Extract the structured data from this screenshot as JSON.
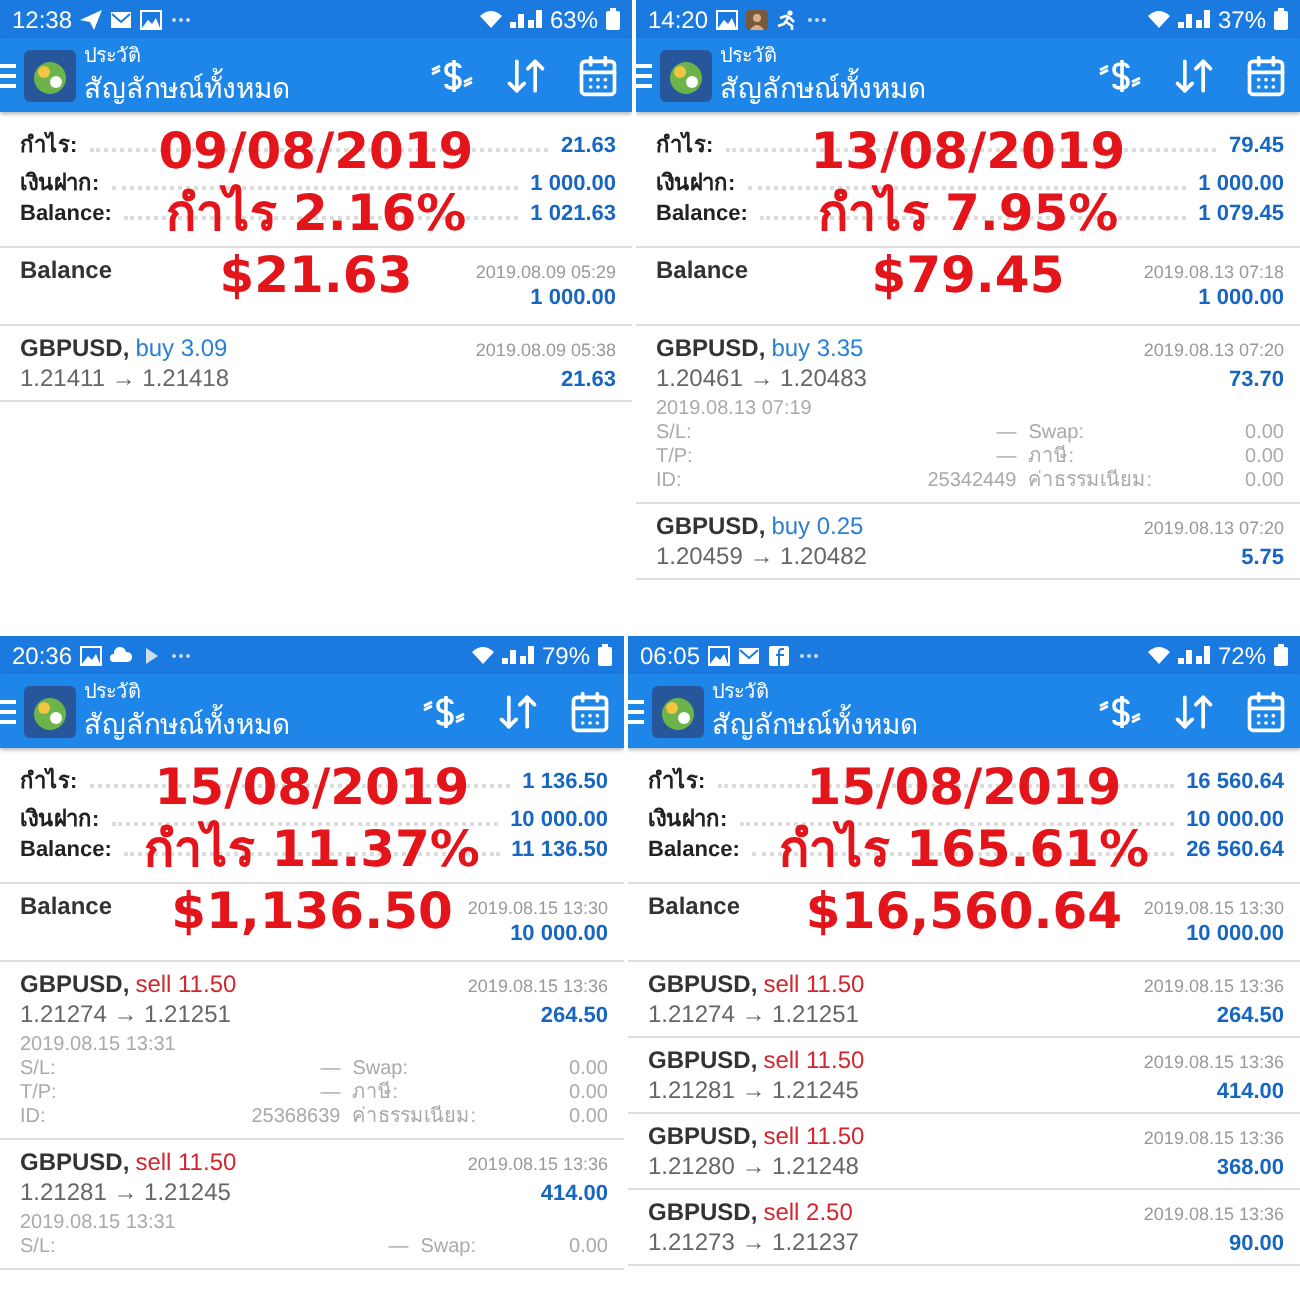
{
  "panels": [
    {
      "status_bar": {
        "time": "12:38",
        "icons": [
          {
            "kind": "send"
          },
          {
            "kind": "mail"
          },
          {
            "kind": "image"
          },
          {
            "kind": "dots"
          }
        ],
        "battery": "63%"
      },
      "header": {
        "subtitle": "ประวัติ",
        "title": "สัญลักษณ์ทั้งหมด"
      },
      "summary": [
        {
          "label": "กำไร:",
          "value": "21.63"
        },
        {
          "label": "เงินฝาก:",
          "value": "1 000.00"
        },
        {
          "label": "Balance:",
          "value": "1 021.63"
        }
      ],
      "overlay": [
        "09/08/2019",
        "กำไร 2.16%",
        "$21.63"
      ],
      "deals": [
        {
          "kind": "balance",
          "title": "Balance",
          "time": "2019.08.09 05:29",
          "amount": "1 000.00"
        },
        {
          "kind": "trade",
          "symbol": "GBPUSD,",
          "color": "#2a7fd4",
          "order": "buy 3.09",
          "prices": "1.21411 → 1.21418",
          "time": "2019.08.09 05:38",
          "amount": "21.63"
        }
      ]
    },
    {
      "status_bar": {
        "time": "14:20",
        "icons": [
          {
            "kind": "image"
          },
          {
            "kind": "avatar"
          },
          {
            "kind": "run"
          },
          {
            "kind": "dots"
          }
        ],
        "battery": "37%"
      },
      "header": {
        "subtitle": "ประวัติ",
        "title": "สัญลักษณ์ทั้งหมด"
      },
      "summary": [
        {
          "label": "กำไร:",
          "value": "79.45"
        },
        {
          "label": "เงินฝาก:",
          "value": "1 000.00"
        },
        {
          "label": "Balance:",
          "value": "1 079.45"
        }
      ],
      "overlay": [
        "13/08/2019",
        "กำไร 7.95%",
        "$79.45"
      ],
      "deals": [
        {
          "kind": "balance",
          "title": "Balance",
          "time": "2019.08.13 07:18",
          "amount": "1 000.00"
        },
        {
          "kind": "trade",
          "symbol": "GBPUSD,",
          "color": "#2a7fd4",
          "order": "buy 3.35",
          "prices": "1.20461 → 1.20483",
          "time": "2019.08.13 07:20",
          "amount": "73.70",
          "details": {
            "open_time": "2019.08.13 07:19",
            "rows": [
              {
                "label": "S/L:",
                "value": "—",
                "label2": "Swap:",
                "value2": "0.00"
              },
              {
                "label": "T/P:",
                "value": "—",
                "label2": "ภาษี:",
                "value2": "0.00"
              },
              {
                "label": "ID:",
                "value": "25342449",
                "label2": "ค่าธรรมเนียม:",
                "value2": "0.00"
              }
            ]
          }
        },
        {
          "kind": "trade",
          "symbol": "GBPUSD,",
          "color": "#2a7fd4",
          "order": "buy 0.25",
          "prices": "1.20459 → 1.20482",
          "time": "2019.08.13 07:20",
          "amount": "5.75"
        }
      ]
    },
    {
      "status_bar": {
        "time": "20:36",
        "icons": [
          {
            "kind": "image"
          },
          {
            "kind": "cloud"
          },
          {
            "kind": "play"
          },
          {
            "kind": "dots"
          }
        ],
        "battery": "79%"
      },
      "header": {
        "subtitle": "ประวัติ",
        "title": "สัญลักษณ์ทั้งหมด"
      },
      "summary": [
        {
          "label": "กำไร:",
          "value": "1 136.50"
        },
        {
          "label": "เงินฝาก:",
          "value": "10 000.00"
        },
        {
          "label": "Balance:",
          "value": "11 136.50"
        }
      ],
      "overlay": [
        "15/08/2019",
        "กำไร 11.37%",
        "$1,136.50"
      ],
      "deals": [
        {
          "kind": "balance",
          "title": "Balance",
          "time": "2019.08.15 13:30",
          "amount": "10 000.00"
        },
        {
          "kind": "trade",
          "symbol": "GBPUSD,",
          "color": "#d0262e",
          "order": "sell 11.50",
          "prices": "1.21274 → 1.21251",
          "time": "2019.08.15 13:36",
          "amount": "264.50",
          "details": {
            "open_time": "2019.08.15 13:31",
            "rows": [
              {
                "label": "S/L:",
                "value": "—",
                "label2": "Swap:",
                "value2": "0.00"
              },
              {
                "label": "T/P:",
                "value": "—",
                "label2": "ภาษี:",
                "value2": "0.00"
              },
              {
                "label": "ID:",
                "value": "25368639",
                "label2": "ค่าธรรมเนียม:",
                "value2": "0.00"
              }
            ]
          }
        },
        {
          "kind": "trade",
          "symbol": "GBPUSD,",
          "color": "#d0262e",
          "order": "sell 11.50",
          "prices": "1.21281 → 1.21245",
          "time": "2019.08.15 13:36",
          "amount": "414.00",
          "details": {
            "open_time": "2019.08.15 13:31",
            "rows": [
              {
                "label": "S/L:",
                "value": "—",
                "label2": "Swap:",
                "value2": "0.00"
              }
            ]
          }
        }
      ]
    },
    {
      "status_bar": {
        "time": "06:05",
        "icons": [
          {
            "kind": "image"
          },
          {
            "kind": "mail"
          },
          {
            "kind": "facebook"
          },
          {
            "kind": "dots"
          }
        ],
        "battery": "72%"
      },
      "header": {
        "subtitle": "ประวัติ",
        "title": "สัญลักษณ์ทั้งหมด"
      },
      "summary": [
        {
          "label": "กำไร:",
          "value": "16 560.64"
        },
        {
          "label": "เงินฝาก:",
          "value": "10 000.00"
        },
        {
          "label": "Balance:",
          "value": "26 560.64"
        }
      ],
      "overlay": [
        "15/08/2019",
        "กำไร 165.61%",
        "$16,560.64"
      ],
      "deals": [
        {
          "kind": "balance",
          "title": "Balance",
          "time": "2019.08.15 13:30",
          "amount": "10 000.00"
        },
        {
          "kind": "trade",
          "symbol": "GBPUSD,",
          "color": "#d0262e",
          "order": "sell 11.50",
          "prices": "1.21274 → 1.21251",
          "time": "2019.08.15 13:36",
          "amount": "264.50"
        },
        {
          "kind": "trade",
          "symbol": "GBPUSD,",
          "color": "#d0262e",
          "order": "sell 11.50",
          "prices": "1.21281 → 1.21245",
          "time": "2019.08.15 13:36",
          "amount": "414.00"
        },
        {
          "kind": "trade",
          "symbol": "GBPUSD,",
          "color": "#d0262e",
          "order": "sell 11.50",
          "prices": "1.21280 → 1.21248",
          "time": "2019.08.15 13:36",
          "amount": "368.00"
        },
        {
          "kind": "trade",
          "symbol": "GBPUSD,",
          "color": "#d0262e",
          "order": "sell 2.50",
          "prices": "1.21273 → 1.21237",
          "time": "2019.08.15 13:36",
          "amount": "90.00"
        }
      ]
    }
  ]
}
